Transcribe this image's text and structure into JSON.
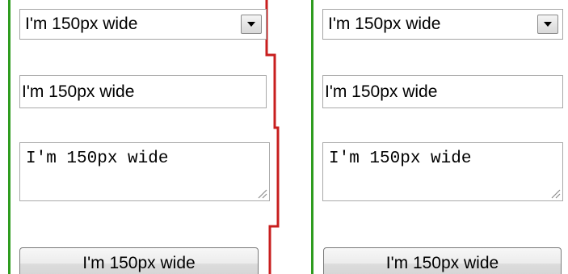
{
  "left_column": {
    "select_value": "I'm 150px wide",
    "input_value": "I'm 150px wide",
    "textarea_value": "I'm 150px wide",
    "button_label": "I'm 150px wide"
  },
  "right_column": {
    "select_value": "I'm 150px wide",
    "input_value": "I'm 150px wide",
    "textarea_value": "I'm 150px wide",
    "button_label": "I'm 150px wide"
  },
  "colors": {
    "left_guide_line": "#2e9c1f",
    "right_guide_line": "#2e9c1f",
    "overflow_line": "#c81e1e"
  },
  "icons": {
    "select_arrow": "chevron-down-icon",
    "textarea_grip": "resize-grip-icon"
  }
}
